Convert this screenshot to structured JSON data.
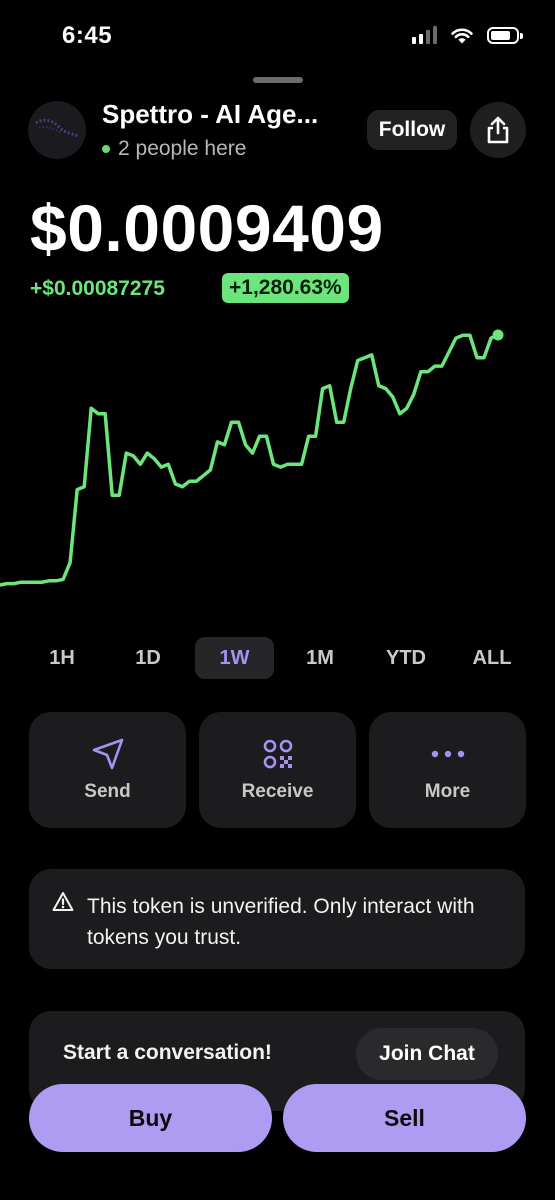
{
  "status_bar": {
    "time": "6:45",
    "icons": [
      "signal-icon",
      "wifi-icon",
      "battery-icon"
    ]
  },
  "header": {
    "token_name": "Spettro - AI Age...",
    "presence": "2 people here",
    "follow_label": "Follow",
    "share_icon": "share-icon"
  },
  "price": {
    "value": "$0.0009409",
    "change_abs": "+$0.00087275",
    "change_pct": "+1,280.63%"
  },
  "colors": {
    "accent": "#ad9cf1",
    "accent_text": "#a792f0",
    "positive": "#6ce57c",
    "card": "#1c1c1e"
  },
  "chart_data": {
    "type": "line",
    "title": "",
    "xlabel": "",
    "ylabel": "",
    "grid": false,
    "range": "1W",
    "series": [
      {
        "values": [
          5e-05,
          5.5e-05,
          5.5e-05,
          6e-05,
          6e-05,
          6e-05,
          6e-05,
          6.5e-05,
          6.5e-05,
          7e-05,
          0.00013,
          0.00039,
          0.0004,
          0.00068,
          0.00066,
          0.00066,
          0.00037,
          0.00037,
          0.00052,
          0.00051,
          0.00048,
          0.00052,
          0.0005,
          0.00047,
          0.00048,
          0.00041,
          0.0004,
          0.00042,
          0.00042,
          0.00044,
          0.00046,
          0.00056,
          0.00055,
          0.00063,
          0.00063,
          0.00055,
          0.00052,
          0.00058,
          0.00058,
          0.00048,
          0.00047,
          0.00048,
          0.00048,
          0.00048,
          0.00058,
          0.00058,
          0.00075,
          0.00076,
          0.00063,
          0.00063,
          0.00075,
          0.00085,
          0.00086,
          0.00087,
          0.00076,
          0.00075,
          0.00072,
          0.00066,
          0.00068,
          0.00073,
          0.00081,
          0.00081,
          0.00083,
          0.00083,
          0.00088,
          0.00093,
          0.00094,
          0.00094,
          0.00086,
          0.00086,
          0.00093,
          0.0009409
        ]
      }
    ]
  },
  "ranges": {
    "items": [
      "1H",
      "1D",
      "1W",
      "1M",
      "YTD",
      "ALL"
    ],
    "active": "1W"
  },
  "actions": {
    "send": {
      "label": "Send",
      "icon": "send-icon"
    },
    "receive": {
      "label": "Receive",
      "icon": "qr-code-icon"
    },
    "more": {
      "label": "More",
      "icon": "more-icon"
    }
  },
  "warning": {
    "text": "This token is unverified. Only interact with tokens you trust.",
    "icon": "warning-icon"
  },
  "conversation": {
    "title": "Start a conversation!",
    "join_label": "Join Chat"
  },
  "trade": {
    "buy_label": "Buy",
    "sell_label": "Sell"
  }
}
